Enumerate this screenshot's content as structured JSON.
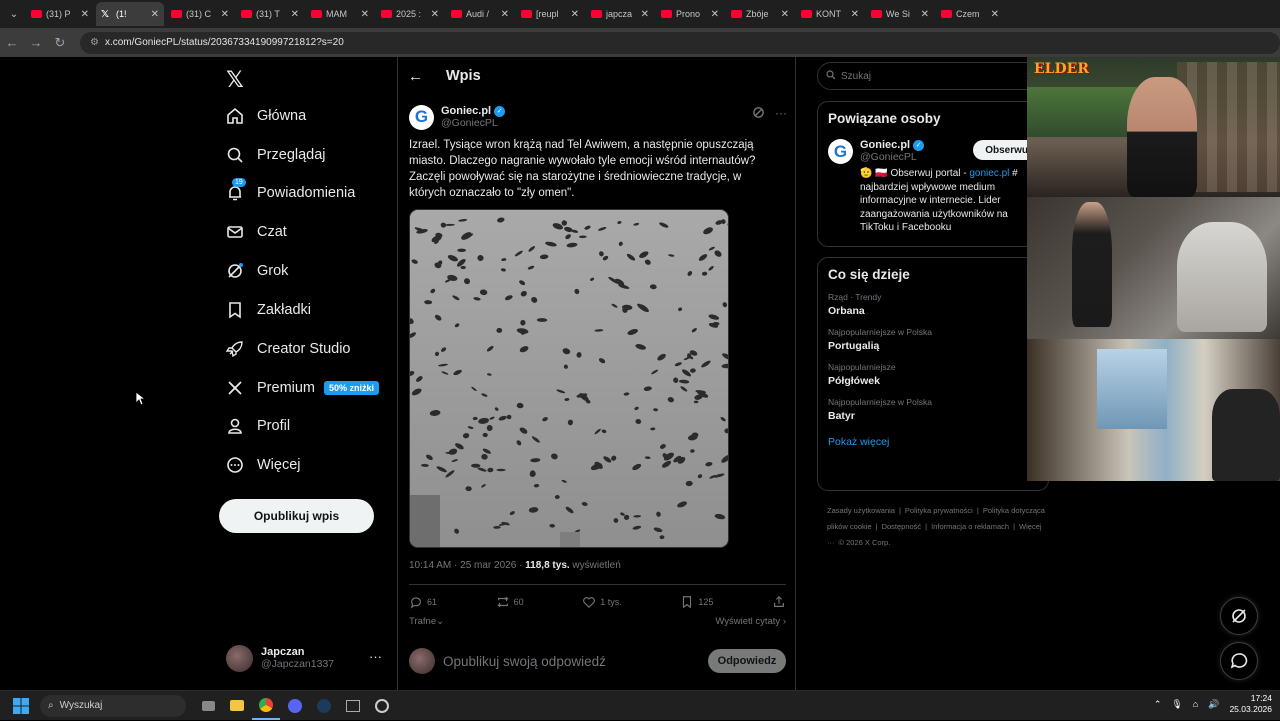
{
  "browser": {
    "tabs": [
      {
        "title": "(31) P",
        "icon": "youtube-icon",
        "active": false
      },
      {
        "title": "(1!",
        "icon": "x-icon",
        "active": true
      },
      {
        "title": "(31) C",
        "icon": "youtube-icon",
        "active": false
      },
      {
        "title": "(31) T",
        "icon": "youtube-icon",
        "active": false
      },
      {
        "title": "MAM",
        "icon": "youtube-icon",
        "active": false
      },
      {
        "title": "2025 :",
        "icon": "youtube-icon",
        "active": false
      },
      {
        "title": "Audi /",
        "icon": "youtube-icon",
        "active": false
      },
      {
        "title": "[reupl",
        "icon": "youtube-icon",
        "active": false
      },
      {
        "title": "japcza",
        "icon": "youtube-icon",
        "active": false
      },
      {
        "title": "Prono",
        "icon": "youtube-icon",
        "active": false
      },
      {
        "title": "Zbóje",
        "icon": "youtube-icon",
        "active": false
      },
      {
        "title": "KONT",
        "icon": "youtube-icon",
        "active": false
      },
      {
        "title": "We Si",
        "icon": "youtube-icon",
        "active": false
      },
      {
        "title": "Czem",
        "icon": "youtube-icon",
        "active": false
      }
    ],
    "url": "x.com/GoniecPL/status/2036733419099721812?s=20"
  },
  "sidebar": {
    "logo": "𝕏",
    "items": [
      {
        "label": "Główna",
        "icon": "home-icon"
      },
      {
        "label": "Przeglądaj",
        "icon": "search-icon"
      },
      {
        "label": "Powiadomienia",
        "icon": "bell-icon",
        "badge": "19"
      },
      {
        "label": "Czat",
        "icon": "mail-icon"
      },
      {
        "label": "Grok",
        "icon": "grok-icon"
      },
      {
        "label": "Zakładki",
        "icon": "bookmark-icon"
      },
      {
        "label": "Creator Studio",
        "icon": "rocket-icon"
      },
      {
        "label": "Premium",
        "icon": "x-icon",
        "promo": "50% zniżki"
      },
      {
        "label": "Profil",
        "icon": "user-icon"
      },
      {
        "label": "Więcej",
        "icon": "more-circle-icon"
      }
    ],
    "post_button": "Opublikuj wpis",
    "account": {
      "name": "Japczan",
      "handle": "@Japczan1337"
    }
  },
  "main": {
    "title": "Wpis",
    "author": {
      "name": "Goniec.pl",
      "handle": "@GoniecPL",
      "logo_letter": "G"
    },
    "text": "Izrael. Tysiące wron krążą nad Tel Awiwem, a następnie opuszczają miasto. Dlaczego nagranie wywołało tyle emocji wśród internautów? Zaczęli powoływać się na starożytne i średniowieczne tradycje, w których oznaczało to \"zły omen\".",
    "meta": {
      "time": "10:14 AM · 25 mar 2026 · ",
      "views": "118,8 tys.",
      "views_label": " wyświetleń"
    },
    "actions": {
      "replies": "61",
      "reposts": "60",
      "likes": "1 tys.",
      "bookmarks": "125"
    },
    "sort_label": "Trafne",
    "quotes_label": "Wyświetl cytaty",
    "reply_placeholder": "Opublikuj swoją odpowiedź",
    "reply_button": "Odpowiedz"
  },
  "right": {
    "search_placeholder": "Szukaj",
    "related": {
      "title": "Powiązane osoby",
      "name": "Goniec.pl",
      "handle": "@GoniecPL",
      "follow": "Obserwuj",
      "bio_prefix": "🫡 🇵🇱 Obserwuj portal - ",
      "bio_link": "goniec.pl",
      "bio_rest": " # najbardziej wpływowe medium informacyjne w internecie. Lider zaangażowania użytkowników na TikToku i Facebooku"
    },
    "trends": {
      "title": "Co się dzieje",
      "items": [
        {
          "meta": "Rząd · Trendy",
          "name": "Orbana"
        },
        {
          "meta": "Najpopularniejsze w Polska",
          "name": "Portugalią"
        },
        {
          "meta": "Najpopularniejsze",
          "name": "Półgłówek"
        },
        {
          "meta": "Najpopularniejsze w Polska",
          "name": "Batyr"
        }
      ],
      "show_more": "Pokaż więcej"
    },
    "footer": [
      "Zasady użytkowania",
      "|",
      "Polityka prywatności",
      "|",
      "Polityka dotycząca plików cookie",
      "|",
      "Dostępność",
      "|",
      "Informacja o reklamach",
      "|",
      "Więcej ···",
      "© 2026 X Corp."
    ]
  },
  "overlay": {
    "logo_text": "ELDER"
  },
  "taskbar": {
    "search_placeholder": "Wyszukaj",
    "time": "17:24",
    "date": "25.03.2026"
  }
}
